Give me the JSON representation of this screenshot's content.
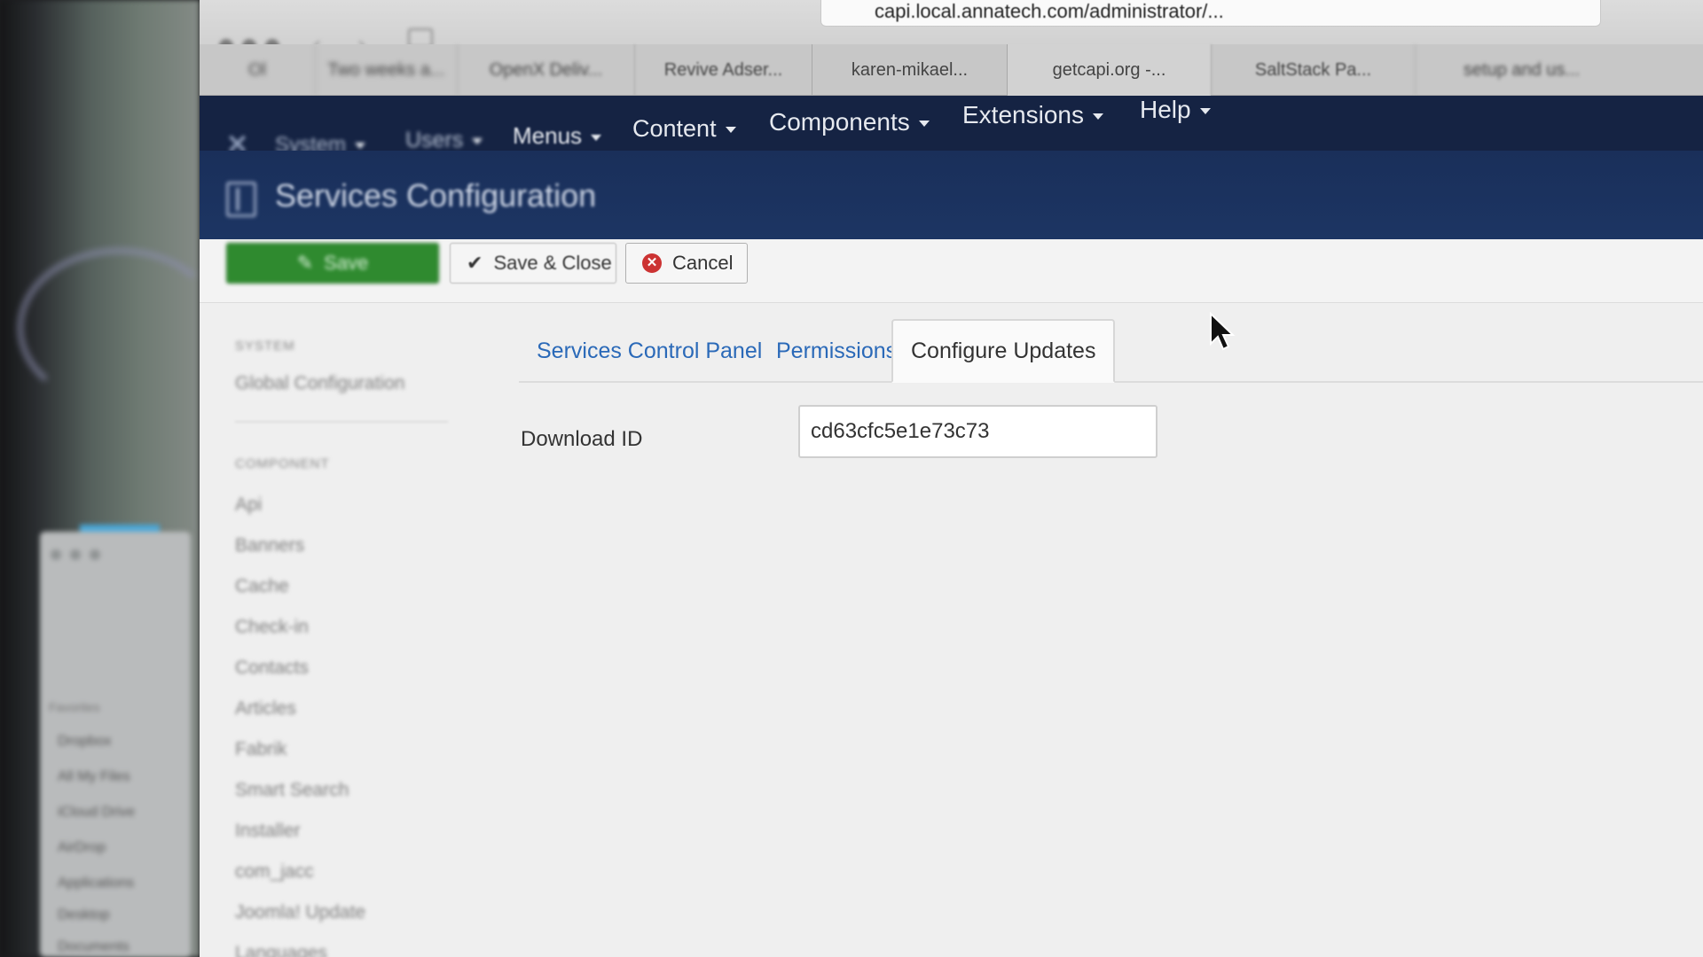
{
  "browser": {
    "url": "capi.local.annatech.com/administrator/...",
    "tabs": [
      {
        "label": "Ol"
      },
      {
        "label": "Two weeks a..."
      },
      {
        "label": "OpenX Deliv..."
      },
      {
        "label": "Revive Adser..."
      },
      {
        "label": "karen-mikael..."
      },
      {
        "label": "getcapi.org -..."
      },
      {
        "label": "SaltStack Pa..."
      },
      {
        "label": "setup and us..."
      }
    ]
  },
  "topnav": {
    "items": [
      {
        "label": "System"
      },
      {
        "label": "Users"
      },
      {
        "label": "Menus"
      },
      {
        "label": "Content"
      },
      {
        "label": "Components"
      },
      {
        "label": "Extensions"
      },
      {
        "label": "Help"
      }
    ]
  },
  "header": {
    "title": "Services Configuration"
  },
  "toolbar": {
    "save_label": "Save",
    "save_close_label": "Save & Close",
    "cancel_label": "Cancel"
  },
  "config_sidebar": {
    "system_heading": "SYSTEM",
    "system_items": [
      {
        "label": "Global Configuration"
      }
    ],
    "component_heading": "COMPONENT",
    "component_items": [
      {
        "label": "Api"
      },
      {
        "label": "Banners"
      },
      {
        "label": "Cache"
      },
      {
        "label": "Check-in"
      },
      {
        "label": "Contacts"
      },
      {
        "label": "Articles"
      },
      {
        "label": "Fabrik"
      },
      {
        "label": "Smart Search"
      },
      {
        "label": "Installer"
      },
      {
        "label": "com_jacc"
      },
      {
        "label": "Joomla! Update"
      },
      {
        "label": "Languages"
      }
    ]
  },
  "tabs": [
    {
      "label": "Services Control Panel"
    },
    {
      "label": "Permissions"
    },
    {
      "label": "Configure Updates"
    }
  ],
  "form": {
    "download_id_label": "Download ID",
    "download_id_value": "cd63cfc5e1e73c73"
  },
  "finder_sidebar": {
    "favorites_heading": "Favorites",
    "items": [
      {
        "label": "Dropbox"
      },
      {
        "label": "All My Files"
      },
      {
        "label": "iCloud Drive"
      },
      {
        "label": "AirDrop"
      },
      {
        "label": "Applications"
      },
      {
        "label": "Desktop"
      },
      {
        "label": "Documents"
      }
    ]
  }
}
